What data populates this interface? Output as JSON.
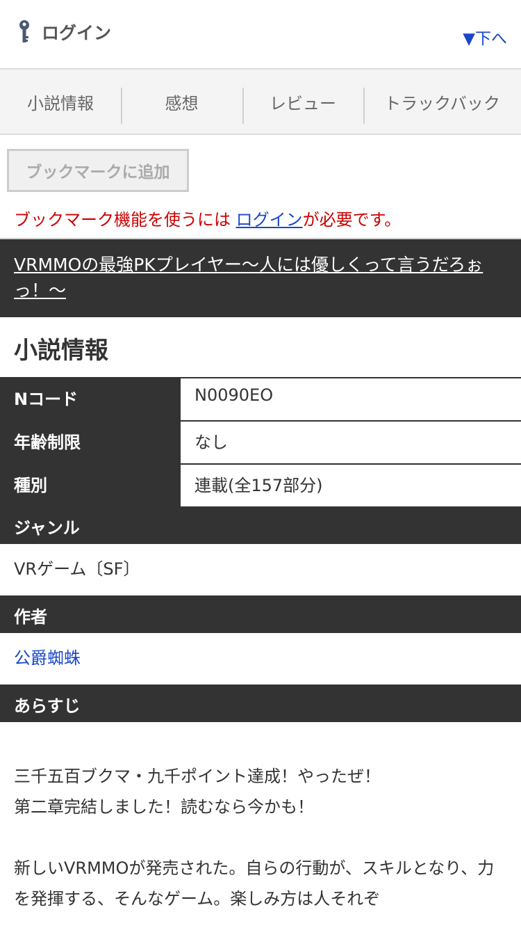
{
  "header": {
    "login_label": "ログイン",
    "down_label": "▼下へ"
  },
  "tabs": [
    "小説情報",
    "感想",
    "レビュー",
    "トラックバック"
  ],
  "bookmark": {
    "button_label": "ブックマークに追加",
    "note_prefix": "ブックマーク機能を使うには ",
    "note_link": "ログイン",
    "note_suffix": "が必要です。"
  },
  "novel": {
    "title": "VRMMOの最強PKプレイヤー〜人には優しくって言うだろぉっ！〜"
  },
  "info": {
    "heading": "小説情報",
    "rows": [
      {
        "label": "Nコード",
        "value": "N0090EO"
      },
      {
        "label": "年齢制限",
        "value": "なし"
      },
      {
        "label": "種別",
        "value": "連載(全157部分)"
      }
    ],
    "genre_label": "ジャンル",
    "genre_value": "VRゲーム〔SF〕",
    "author_label": "作者",
    "author_value": "公爵蜘蛛",
    "synopsis_label": "あらすじ",
    "synopsis_lines": [
      "三千五百ブクマ・九千ポイント達成！やったぜ！",
      "第二章完結しました！読むなら今かも！",
      "新しいVRMMOが発売された。自らの行動が、スキルとなり、力を発揮する、そんなゲーム。楽しみ方は人それぞ"
    ]
  },
  "colors": {
    "dark_bar": "#333333",
    "link": "#1a47c8",
    "warning": "#cc0000"
  }
}
